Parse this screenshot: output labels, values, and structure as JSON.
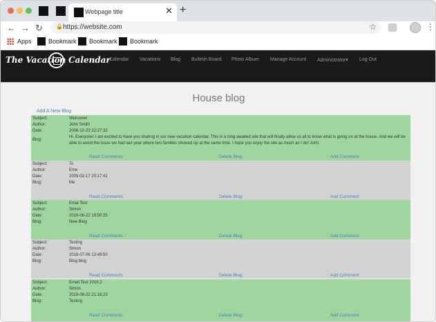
{
  "browser": {
    "tab_title": "Webpage title",
    "url": "https://website.com",
    "bookmarks": {
      "apps": "Apps",
      "items": [
        "Bookmark",
        "Bookmark",
        "Bookmark"
      ]
    }
  },
  "site": {
    "logo_left": "The Vacation",
    "logo_right": "Calendar",
    "nav": [
      "Calendar",
      "Vacations",
      "Blog",
      "Bulletin Board",
      "Photo Album",
      "Manage Account",
      "Administrator▾",
      "Log Out"
    ]
  },
  "page": {
    "title": "House blog",
    "add_link": "Add A New Blog",
    "labels": {
      "subject": "Subject:",
      "author": "Author:",
      "date": "Date:",
      "blog": "Blog:"
    },
    "actions": {
      "read": "Read Comments",
      "delete": "Delete Blog",
      "add": "Add Comment"
    },
    "entries": [
      {
        "subject": "Welcome!",
        "author": "John Smith",
        "date": "2008-10-23 22:27:32",
        "blog": "Hi. Everyone! I am excited to have you sharing in our new vacation calendar. This is a long awaited site that will finally allow us all to know what is going on at the house. And we will be able to avoid the issue we had last year where two families showed up at the same time. I hope you enjoy the site as much as I do! John"
      },
      {
        "subject": "To",
        "author": "Eme",
        "date": "2009-02-17 20:17:41",
        "blog": "Me"
      },
      {
        "subject": "Emai Test",
        "author": "Simon",
        "date": "2016-06-22 19:50:25",
        "blog": "New Blog"
      },
      {
        "subject": "Testing",
        "author": "Simon",
        "date": "2018-07-06 13:49:50",
        "blog": "Blog blog"
      },
      {
        "subject": "Email Test 2018.2",
        "author": "Simon",
        "date": "2018-08-22 21:18:23",
        "blog": "Testing"
      }
    ]
  }
}
